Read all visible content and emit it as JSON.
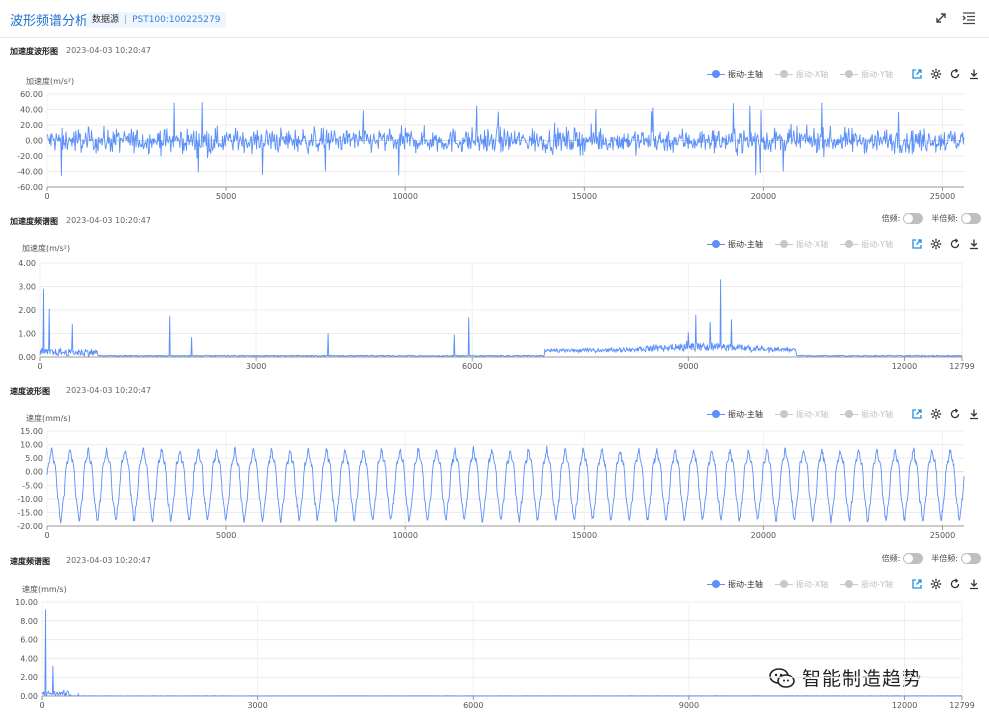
{
  "header": {
    "title": "波形频谱分析",
    "source_label": "数据源",
    "device_id": "PST100:100225279"
  },
  "icons": {
    "expand": "expand-icon",
    "list": "list-menu-icon",
    "export": "export-icon",
    "settings": "gear-icon",
    "refresh": "refresh-icon",
    "download": "download-icon",
    "watermark": "wechat-icon"
  },
  "colors": {
    "accent": "#1f6fd1",
    "series": "#5b8ff9",
    "inactive": "#c8c8c8"
  },
  "toggles": {
    "harmonic": "倍频:",
    "half_harmonic": "半倍频:"
  },
  "legend": [
    "振动-主轴",
    "振动-X轴",
    "振动-Y轴"
  ],
  "watermark": "智能制造趋势",
  "charts": [
    {
      "id": "acc_wave",
      "title": "加速度波形图",
      "time": "2023-04-03 10:20:47",
      "ylabel": "加速度(m/s²)",
      "has_toggles": false,
      "yticks": [
        "60.00",
        "40.00",
        "20.00",
        "0.00",
        "-20.00",
        "-40.00",
        "-60.00"
      ],
      "xticks": [
        "0",
        "5000",
        "10000",
        "15000",
        "20000",
        "25000"
      ]
    },
    {
      "id": "acc_spec",
      "title": "加速度频谱图",
      "time": "2023-04-03 10:20:47",
      "ylabel": "加速度(m/s²)",
      "has_toggles": true,
      "yticks": [
        "4.00",
        "3.00",
        "2.00",
        "1.00",
        "0.00"
      ],
      "xticks": [
        "0",
        "3000",
        "6000",
        "9000",
        "12000",
        "12799"
      ]
    },
    {
      "id": "vel_wave",
      "title": "速度波形图",
      "time": "2023-04-03 10:20:47",
      "ylabel": "速度(mm/s)",
      "has_toggles": false,
      "yticks": [
        "15.00",
        "10.00",
        "5.00",
        "0.00",
        "-5.00",
        "-10.00",
        "-15.00",
        "-20.00"
      ],
      "xticks": [
        "0",
        "5000",
        "10000",
        "15000",
        "20000",
        "25000"
      ]
    },
    {
      "id": "vel_spec",
      "title": "速度频谱图",
      "time": "2023-04-03 10:20:47",
      "ylabel": "速度(mm/s)",
      "has_toggles": true,
      "yticks": [
        "10.00",
        "8.00",
        "6.00",
        "4.00",
        "2.00",
        "0.00"
      ],
      "xticks": [
        "0",
        "3000",
        "6000",
        "9000",
        "12000",
        "12799"
      ]
    }
  ],
  "chart_data": [
    {
      "type": "line",
      "title": "加速度波形图",
      "ylabel": "加速度(m/s²)",
      "xlim": [
        0,
        25600
      ],
      "ylim": [
        -60,
        60
      ],
      "series": [
        {
          "name": "振动-主轴",
          "pattern": "random-noise",
          "amplitude_typical": 20,
          "amplitude_peak": 50
        }
      ]
    },
    {
      "type": "line",
      "title": "加速度频谱图",
      "ylabel": "加速度(m/s²)",
      "xlim": [
        0,
        12799
      ],
      "ylim": [
        0,
        4
      ],
      "series": [
        {
          "name": "振动-主轴",
          "peaks": [
            [
              50,
              2.9
            ],
            [
              130,
              2.05
            ],
            [
              450,
              1.4
            ],
            [
              1800,
              1.75
            ],
            [
              2100,
              0.85
            ],
            [
              4000,
              1.0
            ],
            [
              5750,
              0.95
            ],
            [
              5950,
              1.7
            ],
            [
              9000,
              1.05
            ],
            [
              9100,
              1.8
            ],
            [
              9300,
              1.5
            ],
            [
              9450,
              3.3
            ],
            [
              9600,
              1.6
            ]
          ],
          "floor": 0.05
        }
      ]
    },
    {
      "type": "line",
      "title": "速度波形图",
      "ylabel": "速度(mm/s)",
      "xlim": [
        0,
        25600
      ],
      "ylim": [
        -20,
        15
      ],
      "series": [
        {
          "name": "振动-主轴",
          "pattern": "periodic",
          "cycles": 50,
          "max": 10,
          "min": -17
        }
      ]
    },
    {
      "type": "line",
      "title": "速度频谱图",
      "ylabel": "速度(mm/s)",
      "xlim": [
        0,
        12799
      ],
      "ylim": [
        0,
        10
      ],
      "series": [
        {
          "name": "振动-主轴",
          "peaks": [
            [
              50,
              9.2
            ],
            [
              150,
              3.2
            ],
            [
              300,
              0.6
            ],
            [
              500,
              0.2
            ]
          ],
          "floor": 0.02
        }
      ]
    }
  ]
}
